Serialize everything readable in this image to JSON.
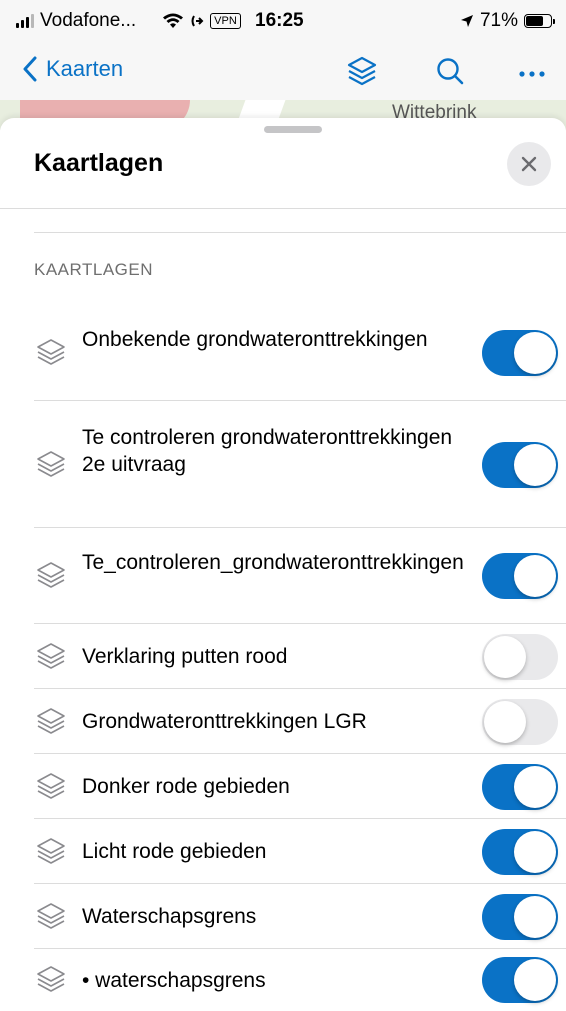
{
  "status_bar": {
    "carrier": "Vodafone...",
    "vpn": "VPN",
    "time": "16:25",
    "battery": "71%",
    "battery_level": 0.71
  },
  "nav": {
    "back_label": "Kaarten",
    "accent": "#0a72c6",
    "icons": [
      "layers-icon",
      "search-icon",
      "more-icon"
    ]
  },
  "map": {
    "label": "Wittebrink"
  },
  "sheet": {
    "title": "Kaartlagen",
    "section_header": "KAARTLAGEN",
    "layers": [
      {
        "label": "Onbekende grondwateronttrekkingen",
        "enabled": true
      },
      {
        "label": "Te controleren grondwateronttrekkingen 2e uitvraag",
        "enabled": true
      },
      {
        "label": "Te_controleren_grondwateronttrekkingen",
        "enabled": true
      },
      {
        "label": "Verklaring putten rood",
        "enabled": false
      },
      {
        "label": "Grondwateronttrekkingen LGR",
        "enabled": false
      },
      {
        "label": "Donker rode gebieden",
        "enabled": true
      },
      {
        "label": "Licht rode gebieden",
        "enabled": true
      },
      {
        "label": "Waterschapsgrens",
        "enabled": true
      },
      {
        "label": "• waterschapsgrens",
        "enabled": true
      }
    ]
  }
}
